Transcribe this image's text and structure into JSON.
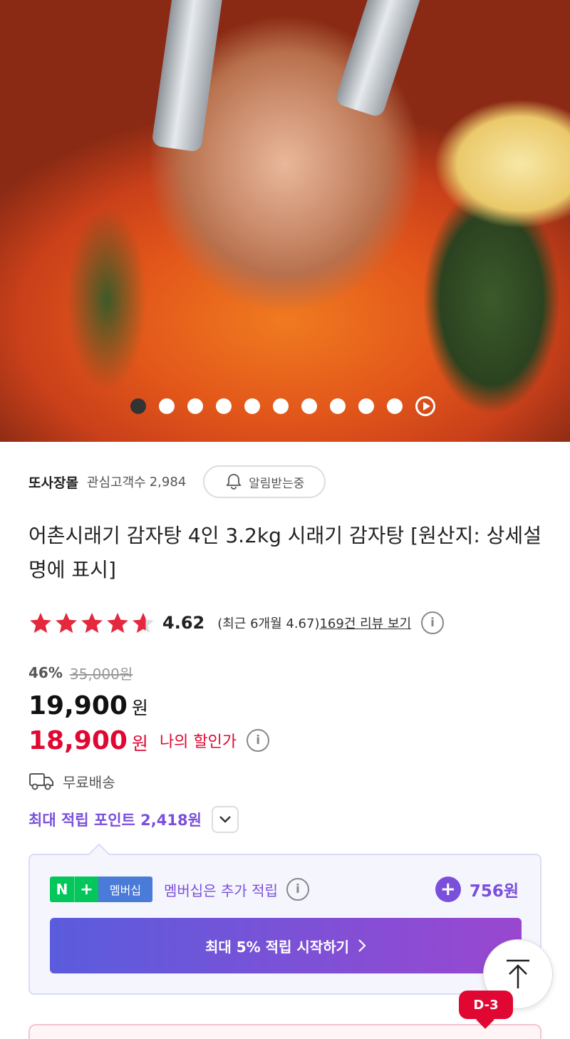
{
  "hero": {
    "image_desc_icon": "food-photo",
    "dot_count": 10,
    "active_index": 0
  },
  "seller": {
    "name": "또사장몰",
    "fans_label": "관심고객수",
    "fans_count": "2,984",
    "alert_label": "알림받는중"
  },
  "product": {
    "title": "어촌시래기 감자탕 4인 3.2kg 시래기 감자탕 [원산지: 상세설명에 표시]"
  },
  "rating": {
    "score": "4.62",
    "stars_value": 4.62,
    "recent": "(최근 6개월 4.67)",
    "review_link": "169건 리뷰 보기"
  },
  "price": {
    "discount_pct": "46%",
    "original": "35,000원",
    "sale": "19,900",
    "unit": "원",
    "my_price": "18,900",
    "my_price_unit": "원",
    "my_price_label": "나의 할인가"
  },
  "shipping": {
    "label": "무료배송"
  },
  "points": {
    "label": "최대 적립 포인트 2,418원"
  },
  "membership": {
    "badge_n": "N",
    "badge_plus": "+",
    "badge_text": "멤버십",
    "text": "멤버십은 추가 적립",
    "amount": "756원",
    "cta": "최대 5% 적립 시작하기"
  },
  "floating": {
    "dday": "D-3"
  },
  "colors": {
    "sale_red": "#e00832",
    "point_purple": "#7a4fdc",
    "naver_green": "#03c75a",
    "star_red": "#e4283e"
  }
}
